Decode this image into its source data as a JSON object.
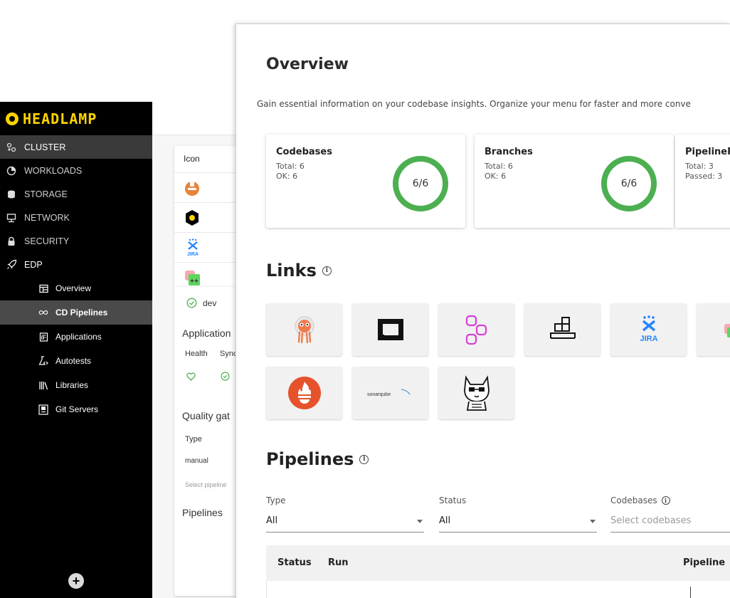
{
  "headlamp": {
    "brand": "HEADLAMP",
    "nav": [
      {
        "label": "CLUSTER",
        "icon": "cluster-icon"
      },
      {
        "label": "WORKLOADS",
        "icon": "workloads-icon"
      },
      {
        "label": "STORAGE",
        "icon": "storage-icon"
      },
      {
        "label": "NETWORK",
        "icon": "network-icon"
      },
      {
        "label": "SECURITY",
        "icon": "lock-icon"
      },
      {
        "label": "EDP",
        "icon": "rocket-icon"
      }
    ],
    "edp_items": [
      {
        "label": "Overview",
        "icon": "dashboard-icon"
      },
      {
        "label": "CD Pipelines",
        "icon": "infinity-icon"
      },
      {
        "label": "Applications",
        "icon": "applications-icon"
      },
      {
        "label": "Autotests",
        "icon": "flask-icon"
      },
      {
        "label": "Libraries",
        "icon": "library-icon"
      },
      {
        "label": "Git Servers",
        "icon": "git-server-icon"
      }
    ],
    "back_card": {
      "column_header": "Icon",
      "env_name": "dev",
      "applications_label": "Application",
      "health_label": "Health",
      "sync_label": "Sync",
      "quality_gates_label": "Quality gat",
      "type_label": "Type",
      "type_value": "manual",
      "select_placeholder": "Select pipeline",
      "pipelines_label": "Pipelines"
    }
  },
  "overview": {
    "title": "Overview",
    "description": "Gain essential information on your codebase insights. Organize your menu for faster and more conve",
    "cards": [
      {
        "name": "Codebases",
        "line1": "Total: 6",
        "line2": "OK: 6",
        "ratio": "6/6",
        "fraction": 1.0
      },
      {
        "name": "Branches",
        "line1": "Total: 6",
        "line2": "OK: 6",
        "ratio": "6/6",
        "fraction": 1.0
      },
      {
        "name": "PipelineR",
        "line1": "Total: 3",
        "line2": "Passed: 3",
        "ratio": "",
        "fraction": 1.0
      }
    ],
    "links_title": "Links",
    "links": [
      {
        "name": "argocd-link",
        "icon": "argocd-icon"
      },
      {
        "name": "defectdojo-link",
        "icon": "square-logo-icon"
      },
      {
        "name": "nexus-link",
        "icon": "nodes-icon"
      },
      {
        "name": "registry-link",
        "icon": "registry-icon"
      },
      {
        "name": "jira-link",
        "icon": "jira-icon",
        "text": "JIRA"
      },
      {
        "name": "extra-link",
        "icon": "partial-icon"
      },
      {
        "name": "prometheus-link",
        "icon": "prometheus-icon"
      },
      {
        "name": "sonarqube-link",
        "icon": "sonarqube-icon",
        "text": "sonarqube"
      },
      {
        "name": "tekton-link",
        "icon": "cat-icon"
      }
    ],
    "pipelines_title": "Pipelines",
    "filters": {
      "type_label": "Type",
      "type_value": "All",
      "status_label": "Status",
      "status_value": "All",
      "codebases_label": "Codebases",
      "codebases_placeholder": "Select codebases"
    },
    "table": {
      "col_status": "Status",
      "col_run": "Run",
      "col_pipeline": "Pipeline"
    }
  },
  "colors": {
    "accent_green": "#4caf50",
    "brand_yellow": "#ffd400"
  }
}
